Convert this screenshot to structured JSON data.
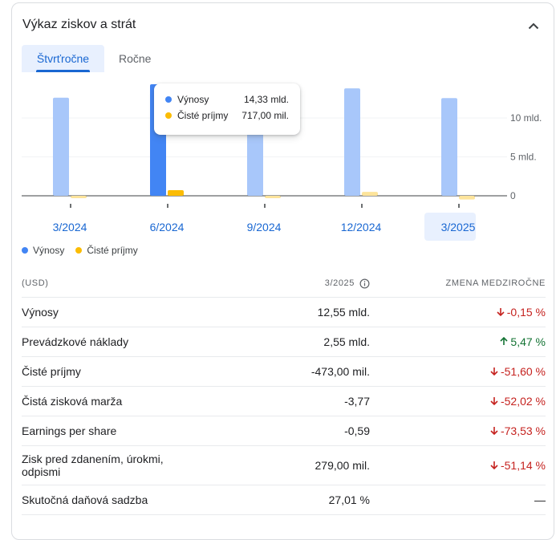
{
  "card": {
    "title": "Výkaz ziskov a strát"
  },
  "tabs": [
    {
      "label": "Štvrťročne",
      "active": true
    },
    {
      "label": "Ročne",
      "active": false
    }
  ],
  "chart_data": {
    "type": "bar",
    "categories": [
      "3/2024",
      "6/2024",
      "9/2024",
      "12/2024",
      "3/2025"
    ],
    "selected_category": "3/2025",
    "highlighted_category": "6/2024",
    "series": [
      {
        "name": "Výnosy",
        "color": "#4285f4",
        "values": [
          12.6,
          14.33,
          12.7,
          13.8,
          12.55
        ]
      },
      {
        "name": "Čisté príjmy",
        "color": "#fbbc04",
        "values": [
          -0.2,
          0.717,
          -0.1,
          0.5,
          -0.473
        ]
      }
    ],
    "y_ticks": [
      {
        "value": 10,
        "label": "10 mld."
      },
      {
        "value": 5,
        "label": "5 mld."
      },
      {
        "value": 0,
        "label": "0"
      }
    ],
    "ylim": [
      -1,
      14.5
    ],
    "legend_position": "bottom-left",
    "tooltip": {
      "rows": [
        {
          "label": "Výnosy",
          "value": "14,33 mld.",
          "color": "#4285f4"
        },
        {
          "label": "Čisté príjmy",
          "value": "717,00 mil.",
          "color": "#fbbc04"
        }
      ]
    }
  },
  "legend": [
    {
      "label": "Výnosy",
      "color": "#4285f4"
    },
    {
      "label": "Čisté príjmy",
      "color": "#fbbc04"
    }
  ],
  "table": {
    "header": {
      "label": "(USD)",
      "period": "3/2025",
      "change": "ZMENA MEDZIROČNE"
    },
    "rows": [
      {
        "label": "Výnosy",
        "value": "12,55 mld.",
        "change": "-0,15 %",
        "direction": "down"
      },
      {
        "label": "Prevádzkové náklady",
        "value": "2,55 mld.",
        "change": "5,47 %",
        "direction": "up"
      },
      {
        "label": "Čisté príjmy",
        "value": "-473,00 mil.",
        "change": "-51,60 %",
        "direction": "down"
      },
      {
        "label": "Čistá zisková marža",
        "value": "-3,77",
        "change": "-52,02 %",
        "direction": "down"
      },
      {
        "label": "Earnings per share",
        "value": "-0,59",
        "change": "-73,53 %",
        "direction": "down"
      },
      {
        "label": "Zisk pred zdanením, úrokmi, odpismi",
        "value": "279,00 mil.",
        "change": "-51,14 %",
        "direction": "down"
      },
      {
        "label": "Skutočná daňová sadzba",
        "value": "27,01 %",
        "change": "—",
        "direction": "none"
      }
    ]
  },
  "icons": {
    "collapse": "chevron-up-icon",
    "info": "info-icon",
    "up": "arrow-up-icon",
    "down": "arrow-down-icon"
  }
}
